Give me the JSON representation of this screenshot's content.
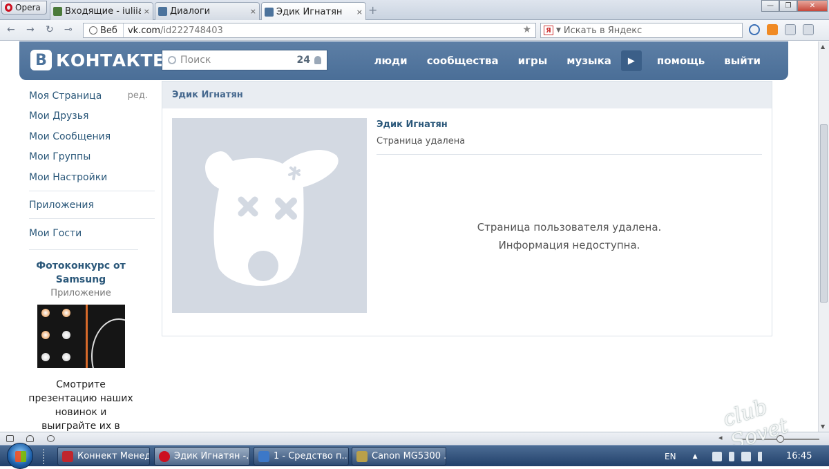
{
  "browser": {
    "menu_label": "Opera",
    "tabs": [
      {
        "label": "Входящие - iuliia-...",
        "close": "×",
        "favicon_color": "#4a7a3a"
      },
      {
        "label": "Диалоги",
        "close": "×",
        "favicon_color": "#4c739c"
      },
      {
        "label": "Эдик Игнатян",
        "close": "×",
        "favicon_color": "#4c739c",
        "active": true
      }
    ],
    "new_tab": "+",
    "window_buttons": [
      "—",
      "❐",
      "✕"
    ],
    "nav": {
      "back": "←",
      "forward": "→",
      "reload": "↻",
      "key": "⊸"
    },
    "site_label": "Веб",
    "url_domain": "vk.com",
    "url_path": "/id222748403",
    "bookmark_star": "★",
    "search_logo": "Я",
    "search_placeholder": "Искать в Яндекс"
  },
  "vk": {
    "logo_letter": "В",
    "logo_word": "КОНТАКТЕ",
    "search": {
      "placeholder": "Поиск",
      "count": "24"
    },
    "nav": [
      "люди",
      "сообщества",
      "игры",
      "музыка",
      "помощь",
      "выйти"
    ],
    "nav_more": "▶"
  },
  "left_menu": {
    "items": [
      {
        "label": "Моя Страница",
        "extra": "ред."
      },
      {
        "label": "Мои Друзья"
      },
      {
        "label": "Мои Сообщения"
      },
      {
        "label": "Мои Группы"
      },
      {
        "label": "Мои Настройки"
      }
    ],
    "apps": "Приложения",
    "guests": "Мои Гости",
    "promo": {
      "title": "Фотоконкурс от Samsung",
      "subtitle": "Приложение",
      "text": "Смотрите презентацию наших новинок и выиграйте их в конкурсе"
    }
  },
  "profile": {
    "header": "Эдик Игнатян",
    "name": "Эдик Игнатян",
    "status": "Страница удалена",
    "message_line1": "Страница пользователя удалена.",
    "message_line2": "Информация недоступна."
  },
  "taskbar": {
    "items": [
      {
        "label": "Коннект Менед...",
        "icon_color": "#c0262d"
      },
      {
        "label": "Эдик Игнатян -...",
        "icon_color": "#cc1020",
        "active": true
      },
      {
        "label": "1 - Средство п...",
        "icon_color": "#3c78c8"
      },
      {
        "label": "Canon MG5300 ...",
        "icon_color": "#b9a04a"
      }
    ],
    "lang": "EN",
    "time": "16:45"
  },
  "watermark": "club Sovet"
}
